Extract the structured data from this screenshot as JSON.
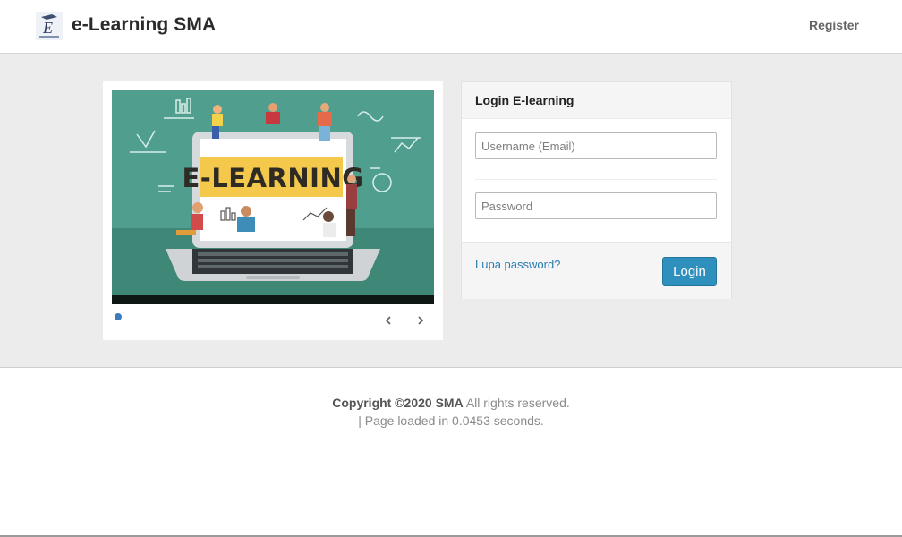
{
  "header": {
    "brand": "e-Learning SMA",
    "register_label": "Register",
    "logo_icon": "school-logo-icon"
  },
  "slider": {
    "banner_text": "E-LEARNING",
    "indicator_color": "#3a7bbf",
    "prev_icon": "chevron-left-icon",
    "next_icon": "chevron-right-icon"
  },
  "login": {
    "title": "Login E-learning",
    "username_placeholder": "Username (Email)",
    "password_placeholder": "Password",
    "forgot_label": "Lupa password?",
    "button_label": "Login",
    "button_color": "#2f8fbd"
  },
  "footer": {
    "copyright_prefix": "Copyright ©2020 ",
    "org": "SMA",
    "rights": " All rights reserved.",
    "load_text": "| Page loaded in 0.0453 seconds."
  }
}
